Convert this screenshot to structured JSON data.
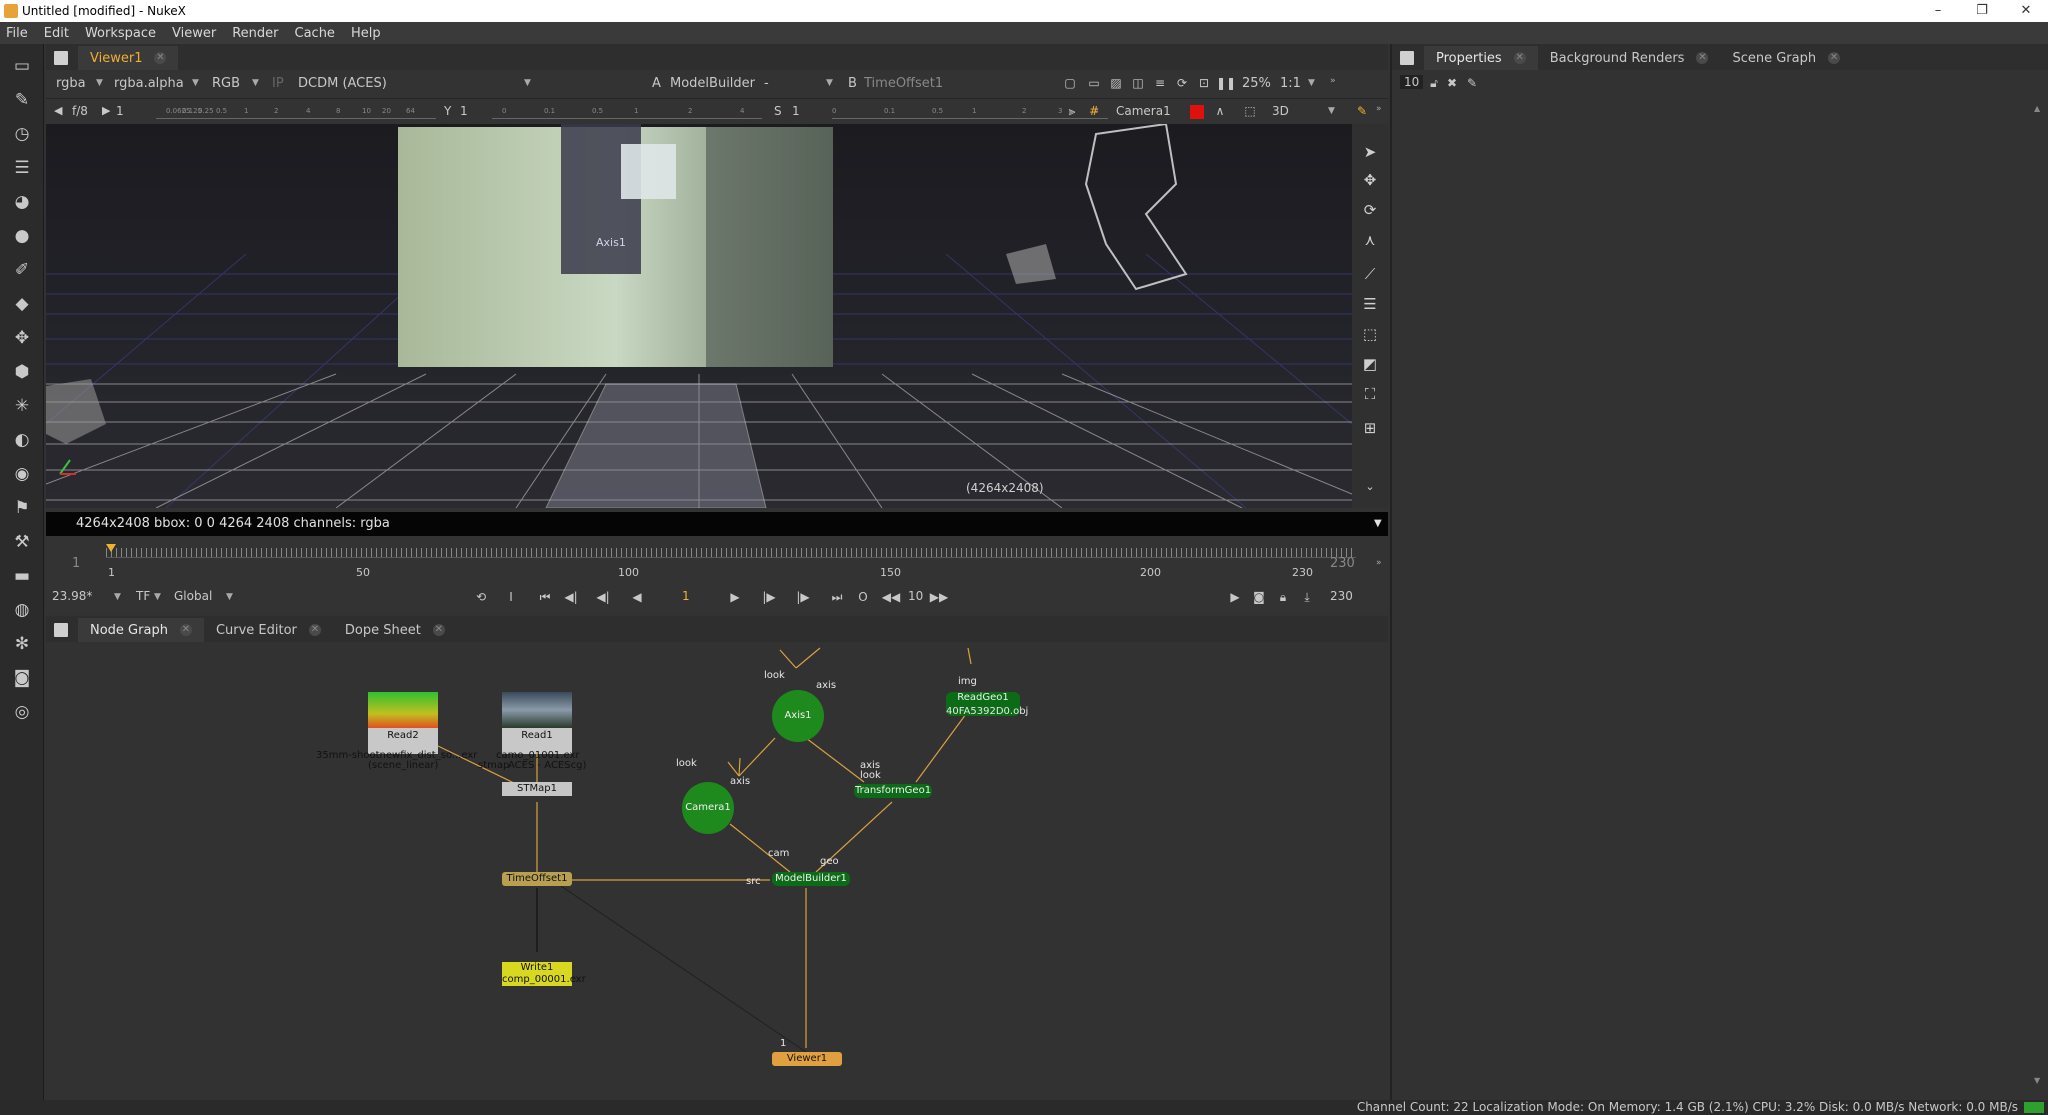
{
  "window": {
    "title": "Untitled [modified] - NukeX"
  },
  "menu": [
    "File",
    "Edit",
    "Workspace",
    "Viewer",
    "Render",
    "Cache",
    "Help"
  ],
  "viewer_panel": {
    "tab": "Viewer1",
    "channels": "rgba",
    "channel_alpha": "rgba.alpha",
    "display": "RGB",
    "ip": "IP",
    "colorspace": "DCDM (ACES)",
    "a_label": "A",
    "a_input": "ModelBuilder",
    "a_dash": "-",
    "b_label": "B",
    "b_input": "TimeOffset1",
    "zoom": "25%",
    "ratio": "1:1",
    "fstop": "f/8",
    "gain": "1",
    "gamma_label": "Y",
    "gamma": "1",
    "s_label": "S",
    "s_value": "1",
    "camera": "Camera1",
    "mode": "3D",
    "resolution_overlay": "(4264x2408)",
    "axis_overlay": "Axis1",
    "info": "4264x2408  bbox: 0 0 4264 2408 channels: rgba",
    "gain_ticks": [
      "0.0625",
      "0.125",
      "0.25",
      "0.5",
      "1",
      "2",
      "4",
      "8",
      "10",
      "20",
      "64"
    ],
    "gamma_ticks": [
      "0",
      "0.1",
      "0.5",
      "1",
      "2",
      "4"
    ],
    "s_ticks": [
      "0",
      "0.1",
      "0.5",
      "1",
      "2",
      "3",
      "4"
    ]
  },
  "timeline": {
    "start": "1",
    "end": "230",
    "end_right": "230",
    "ticks": [
      "1",
      "50",
      "100",
      "150",
      "200",
      "230"
    ],
    "fps": "23.98*",
    "tf": "TF",
    "global": "Global",
    "current_frame": "1",
    "step": "10",
    "out_frame": "230"
  },
  "bottom_tabs": [
    "Node Graph",
    "Curve Editor",
    "Dope Sheet"
  ],
  "right_tabs": [
    "Properties",
    "Background Renders",
    "Scene Graph"
  ],
  "properties_count": "10",
  "nodes": {
    "read2": {
      "name": "Read2",
      "sub1": "35mm-shootnewfix_dist_so...exr",
      "sub2": "(scene_linear)"
    },
    "read1": {
      "name": "Read1",
      "sub1": "camo_01001.exr",
      "sub2": "ACES - ACEScg)"
    },
    "stmap": {
      "name": "STMap1",
      "in_label": "stmap"
    },
    "timeoffset": {
      "name": "TimeOffset1"
    },
    "write": {
      "name": "Write1",
      "sub": "comp_00001.exr"
    },
    "axis": {
      "name": "Axis1",
      "in_look": "look",
      "in_axis": "axis"
    },
    "camera": {
      "name": "Camera1",
      "in_look": "look",
      "in_axis": "axis"
    },
    "readgeo": {
      "name": "ReadGeo1",
      "sub": "40FA5392D0.obj",
      "in_img": "img"
    },
    "transformgeo": {
      "name": "TransformGeo1",
      "in_axis": "axis",
      "in_look": "look"
    },
    "modelbuilder": {
      "name": "ModelBuilder1",
      "in_src": "src",
      "in_cam": "cam",
      "in_geo": "geo"
    },
    "viewer": {
      "name": "Viewer1",
      "in_1": "1"
    }
  },
  "status": "Channel Count: 22  Localization Mode: On  Memory: 1.4 GB (2.1%)  CPU: 3.2%  Disk: 0.0 MB/s  Network: 0.0 MB/s",
  "colors": {
    "accent": "#f0b030",
    "node_green": "#1e8a1e",
    "node_dark_green": "#0c6b16",
    "timeoffset": "#b8a050",
    "write": "#d8d820",
    "viewer_node": "#e0a040"
  }
}
